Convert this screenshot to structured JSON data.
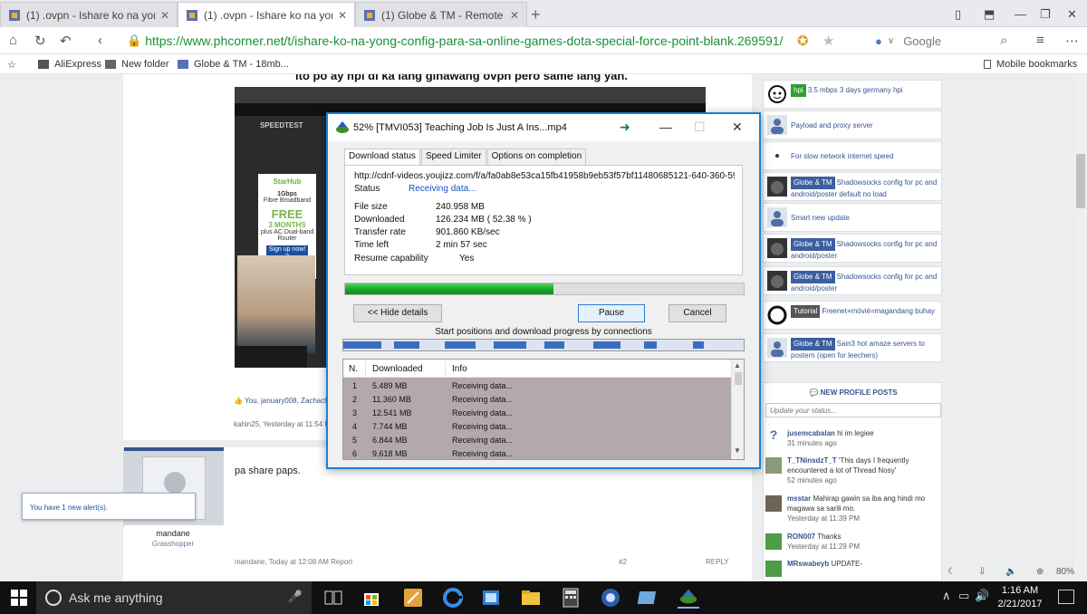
{
  "tabs": [
    {
      "label": "(1) .ovpn - Ishare ko na yong c",
      "active": false
    },
    {
      "label": "(1) .ovpn - Ishare ko na yong c",
      "active": true
    },
    {
      "label": "(1) Globe & TM - Remote pro",
      "active": false
    }
  ],
  "address": {
    "url": "https://www.phcorner.net/t/ishare-ko-na-yong-config-para-sa-online-games-dota-special-force-point-blank.269591/",
    "search_engine": "Google"
  },
  "bookmarks": [
    "AliExpress",
    "New folder",
    "Globe & TM - 18mb...",
    "Mobile bookmarks"
  ],
  "post": {
    "headline": "ito po ay hpi di ka lang ginawang ovpn pero same lang yan.",
    "screenshot_label": "SPEEDTEST",
    "ad": {
      "brand": "StarHub",
      "line1": "1Gbps",
      "line2": "Fibre Broadband",
      "line3": "FREE",
      "line4": "3 MONTHS",
      "line5": "plus AC Dual-band Router",
      "cta": "Sign up now! >"
    },
    "likes": "You, january008, Zachachi",
    "meta": "kahin25, Yesterday at 11:54 P",
    "reply_user": "mandane",
    "reply_rank": "Grasshopper",
    "reply_text": "pa share paps.",
    "reply_meta": "mandane, Today at 12:08 AM   Report",
    "reply_num": "#2",
    "reply_action": "REPLY"
  },
  "alert": "You have 1 new alert(s).",
  "sidebar": {
    "items": [
      {
        "tag": "hpi",
        "tag_color": "green",
        "text": "3.5 mbps 3 days germany hpi"
      },
      {
        "tag": "",
        "text": "Payload and proxy server"
      },
      {
        "tag": "",
        "text": "For slow network internet speed"
      },
      {
        "tag": "Globe & TM",
        "text": "Shadowsocks config for pc and android/poster default no load"
      },
      {
        "tag": "",
        "text": "Smart new update"
      },
      {
        "tag": "Globe & TM",
        "text": "Shadowsocks config for pc and android/poster"
      },
      {
        "tag": "Globe & TM",
        "text": "Shadowsocks config for pc and android/poster"
      },
      {
        "tag": "Tutorial",
        "tag_color": "gray",
        "text": "Freenet+mövié=magandang buhay"
      },
      {
        "tag": "Globe & TM",
        "text": "Sain3 hot amaze servers to postern (open for leechers)"
      }
    ],
    "new_posts": {
      "heading": "NEW PROFILE POSTS",
      "placeholder": "Update your status...",
      "posts": [
        {
          "user": "jusemcabalan",
          "text": "hi im legiee",
          "time": "31 minutes ago"
        },
        {
          "user": "T_TNinsdzT_T",
          "text": "'This days I frequently encountered a lot of Thread Nosy'",
          "time": "52 minutes ago"
        },
        {
          "user": "msstar",
          "text": "Mahirap gawin sa iba ang hindi mo magawa sa sarili mo.",
          "time": "Yesterday at 11:39 PM"
        },
        {
          "user": "RON007",
          "text": "Thanks",
          "time": "Yesterday at 11:29 PM"
        },
        {
          "user": "MRswabeyb",
          "text": "UPDATE-",
          "time": ""
        }
      ]
    }
  },
  "zoom": "80%",
  "idm": {
    "title": "52% [TMVI053] Teaching Job Is Just A Ins...mp4",
    "tabs": [
      "Download status",
      "Speed Limiter",
      "Options on completion"
    ],
    "url": "http://cdnf-videos.youjizz.com/f/a/fa0ab8e53ca15fb41958b9eb53f57bf11480685121-640-360-598-",
    "status_label": "Status",
    "status_value": "Receiving data...",
    "rows": [
      {
        "label": "File size",
        "value": "240.958  MB"
      },
      {
        "label": "Downloaded",
        "value": "126.234  MB  ( 52.38 % )"
      },
      {
        "label": "Transfer rate",
        "value": "901.860  KB/sec"
      },
      {
        "label": "Time left",
        "value": "2 min 57 sec"
      },
      {
        "label": "Resume capability",
        "value": "Yes"
      }
    ],
    "progress_percent": 52.38,
    "btn_hide": "<< Hide details",
    "btn_pause": "Pause",
    "btn_cancel": "Cancel",
    "connections_label": "Start positions and download progress by connections",
    "table_headers": [
      "N.",
      "Downloaded",
      "Info"
    ],
    "connections": [
      {
        "n": "1",
        "downloaded": "5.489  MB",
        "info": "Receiving data..."
      },
      {
        "n": "2",
        "downloaded": "11.360  MB",
        "info": "Receiving data..."
      },
      {
        "n": "3",
        "downloaded": "12.541  MB",
        "info": "Receiving data..."
      },
      {
        "n": "4",
        "downloaded": "7.744  MB",
        "info": "Receiving data..."
      },
      {
        "n": "5",
        "downloaded": "6.844  MB",
        "info": "Receiving data..."
      },
      {
        "n": "6",
        "downloaded": "9.618  MB",
        "info": "Receiving data..."
      }
    ]
  },
  "taskbar": {
    "search_placeholder": "Ask me anything",
    "time": "1:16 AM",
    "date": "2/21/2017"
  }
}
